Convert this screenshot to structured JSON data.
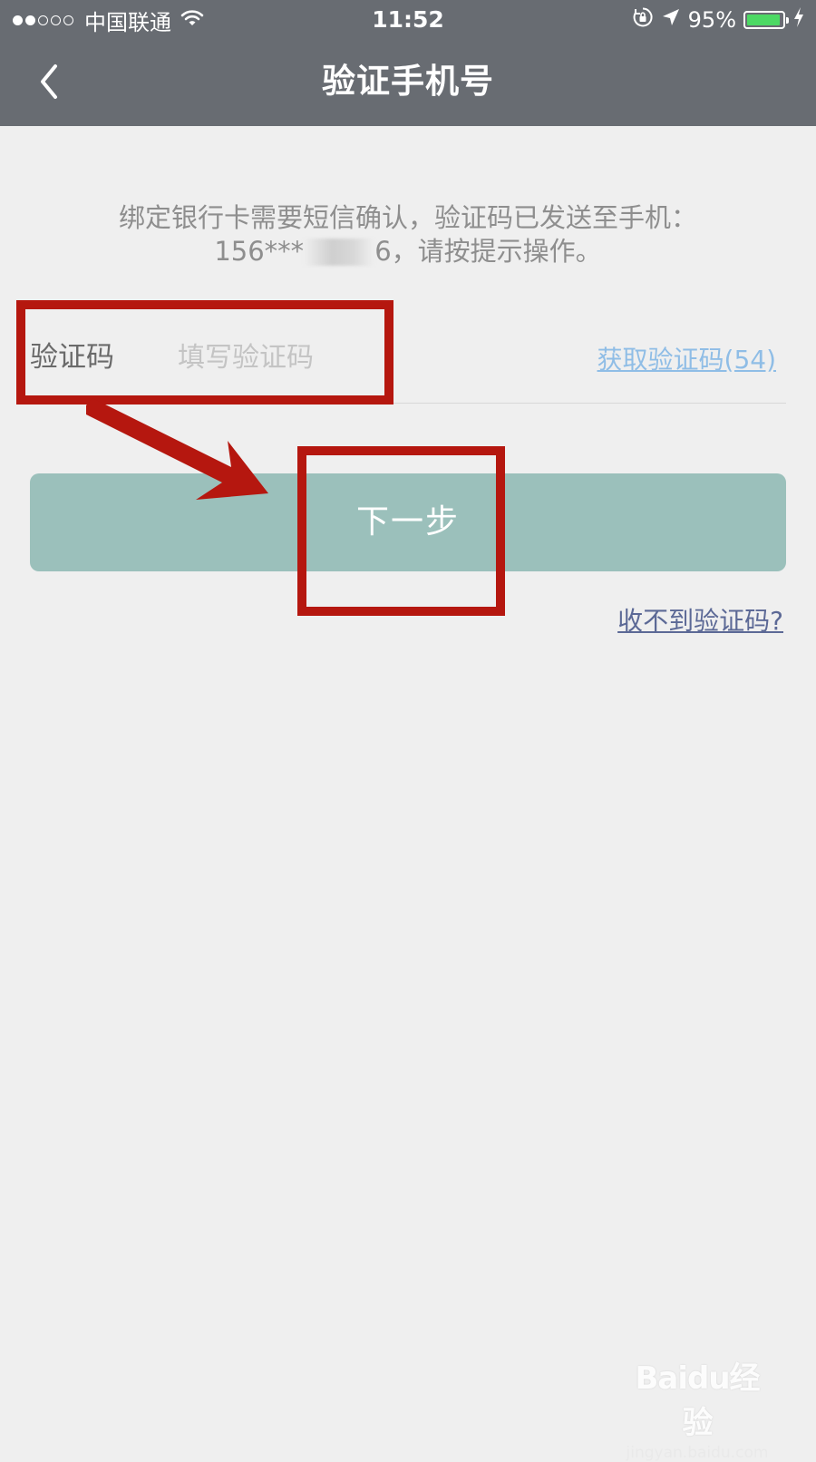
{
  "status_bar": {
    "carrier": "中国联通",
    "time": "11:52",
    "battery_percent": "95%",
    "signal_bars_filled": 2,
    "signal_bars_total": 5,
    "battery_level": 0.95,
    "icons": [
      "wifi-icon",
      "orientation-lock-icon",
      "location-arrow-icon",
      "battery-icon",
      "charging-bolt-icon"
    ]
  },
  "nav": {
    "back_icon": "chevron-left-icon",
    "title": "验证手机号"
  },
  "info": {
    "line1": "绑定银行卡需要短信确认，验证码已发送至手机：",
    "phone_prefix": "156***",
    "phone_suffix": "6",
    "line2_tail": "，请按提示操作。"
  },
  "form": {
    "code_label": "验证码",
    "code_value": "",
    "code_placeholder": "填写验证码",
    "get_code_link": "获取验证码(54)"
  },
  "actions": {
    "next_label": "下一步",
    "no_code_link": "收不到验证码?"
  },
  "watermark": {
    "logo_text": "Baidu经验",
    "url": "jingyan.baidu.com"
  },
  "colors": {
    "nav_background": "#686c72",
    "page_background": "#efefef",
    "next_button": "#9bc0bb",
    "get_code_link": "#8fbde6",
    "no_code_link": "#5c6996",
    "annotation_red": "#b5170f",
    "battery_green": "#4cd964"
  }
}
